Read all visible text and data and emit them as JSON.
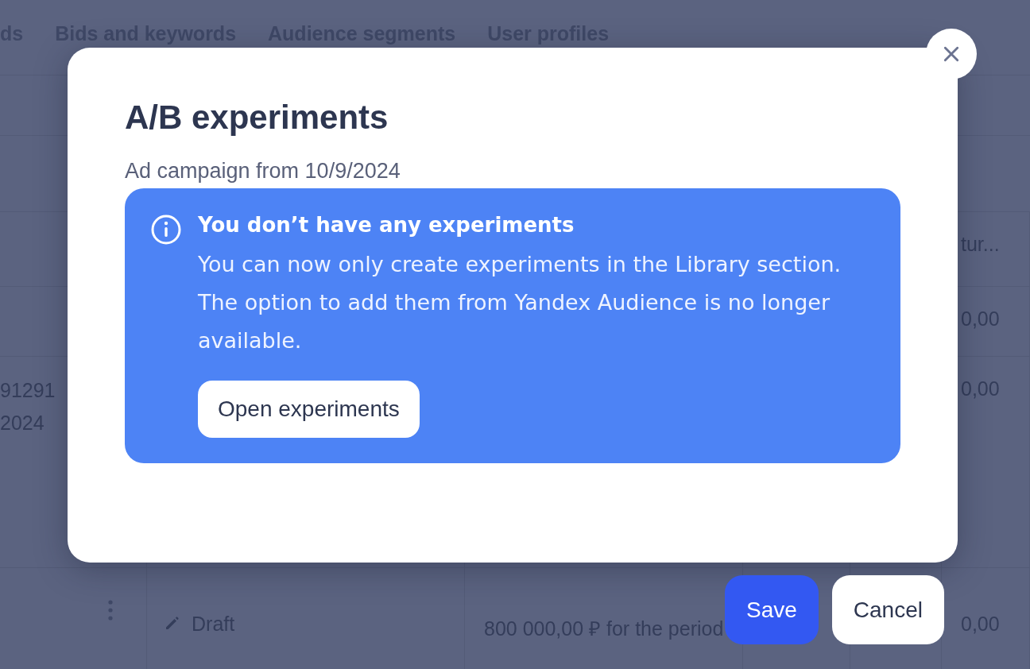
{
  "tabs": [
    {
      "label": "ds"
    },
    {
      "label": "Bids and keywords"
    },
    {
      "label": "Audience segments"
    },
    {
      "label": "User profiles"
    }
  ],
  "table": {
    "header": {
      "column_6": "tur..."
    },
    "rows": [
      {
        "column_6": "0,00"
      },
      {
        "column_1": [
          "91291",
          "2024"
        ],
        "column_6": "0,00"
      },
      {
        "has_menu": true,
        "status": {
          "kind": "draft",
          "label": "Draft"
        },
        "column_3": "800 000,00 ₽ for the period",
        "column_6": "0,00"
      }
    ]
  },
  "dialog": {
    "title": "A/B experiments",
    "subtitle": "Ad campaign from 10/9/2024",
    "notice": {
      "kind": "info",
      "title": "You don’t have any experiments",
      "text": "You can now only create experiments in the Library section. The option to add them from Yandex Audience is no longer available.",
      "button": "Open experiments"
    }
  },
  "actions": [
    {
      "label": "Save",
      "kind": "primary"
    },
    {
      "label": "Cancel",
      "kind": "secondary"
    }
  ]
}
